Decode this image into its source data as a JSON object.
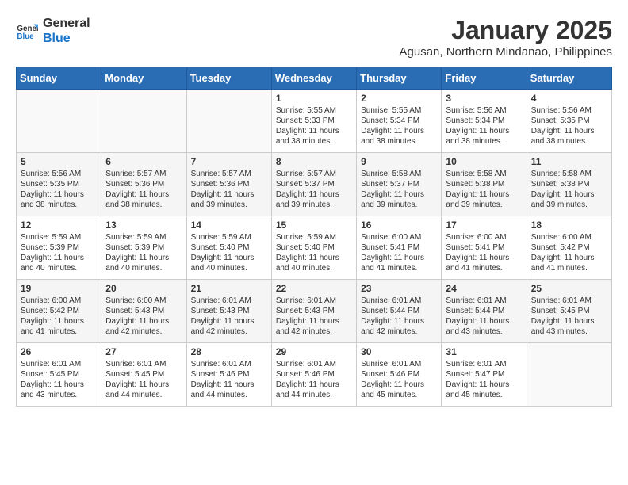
{
  "logo": {
    "line1": "General",
    "line2": "Blue"
  },
  "title": "January 2025",
  "location": "Agusan, Northern Mindanao, Philippines",
  "headers": [
    "Sunday",
    "Monday",
    "Tuesday",
    "Wednesday",
    "Thursday",
    "Friday",
    "Saturday"
  ],
  "weeks": [
    [
      {
        "day": "",
        "content": ""
      },
      {
        "day": "",
        "content": ""
      },
      {
        "day": "",
        "content": ""
      },
      {
        "day": "1",
        "content": "Sunrise: 5:55 AM\nSunset: 5:33 PM\nDaylight: 11 hours\nand 38 minutes."
      },
      {
        "day": "2",
        "content": "Sunrise: 5:55 AM\nSunset: 5:34 PM\nDaylight: 11 hours\nand 38 minutes."
      },
      {
        "day": "3",
        "content": "Sunrise: 5:56 AM\nSunset: 5:34 PM\nDaylight: 11 hours\nand 38 minutes."
      },
      {
        "day": "4",
        "content": "Sunrise: 5:56 AM\nSunset: 5:35 PM\nDaylight: 11 hours\nand 38 minutes."
      }
    ],
    [
      {
        "day": "5",
        "content": "Sunrise: 5:56 AM\nSunset: 5:35 PM\nDaylight: 11 hours\nand 38 minutes."
      },
      {
        "day": "6",
        "content": "Sunrise: 5:57 AM\nSunset: 5:36 PM\nDaylight: 11 hours\nand 38 minutes."
      },
      {
        "day": "7",
        "content": "Sunrise: 5:57 AM\nSunset: 5:36 PM\nDaylight: 11 hours\nand 39 minutes."
      },
      {
        "day": "8",
        "content": "Sunrise: 5:57 AM\nSunset: 5:37 PM\nDaylight: 11 hours\nand 39 minutes."
      },
      {
        "day": "9",
        "content": "Sunrise: 5:58 AM\nSunset: 5:37 PM\nDaylight: 11 hours\nand 39 minutes."
      },
      {
        "day": "10",
        "content": "Sunrise: 5:58 AM\nSunset: 5:38 PM\nDaylight: 11 hours\nand 39 minutes."
      },
      {
        "day": "11",
        "content": "Sunrise: 5:58 AM\nSunset: 5:38 PM\nDaylight: 11 hours\nand 39 minutes."
      }
    ],
    [
      {
        "day": "12",
        "content": "Sunrise: 5:59 AM\nSunset: 5:39 PM\nDaylight: 11 hours\nand 40 minutes."
      },
      {
        "day": "13",
        "content": "Sunrise: 5:59 AM\nSunset: 5:39 PM\nDaylight: 11 hours\nand 40 minutes."
      },
      {
        "day": "14",
        "content": "Sunrise: 5:59 AM\nSunset: 5:40 PM\nDaylight: 11 hours\nand 40 minutes."
      },
      {
        "day": "15",
        "content": "Sunrise: 5:59 AM\nSunset: 5:40 PM\nDaylight: 11 hours\nand 40 minutes."
      },
      {
        "day": "16",
        "content": "Sunrise: 6:00 AM\nSunset: 5:41 PM\nDaylight: 11 hours\nand 41 minutes."
      },
      {
        "day": "17",
        "content": "Sunrise: 6:00 AM\nSunset: 5:41 PM\nDaylight: 11 hours\nand 41 minutes."
      },
      {
        "day": "18",
        "content": "Sunrise: 6:00 AM\nSunset: 5:42 PM\nDaylight: 11 hours\nand 41 minutes."
      }
    ],
    [
      {
        "day": "19",
        "content": "Sunrise: 6:00 AM\nSunset: 5:42 PM\nDaylight: 11 hours\nand 41 minutes."
      },
      {
        "day": "20",
        "content": "Sunrise: 6:00 AM\nSunset: 5:43 PM\nDaylight: 11 hours\nand 42 minutes."
      },
      {
        "day": "21",
        "content": "Sunrise: 6:01 AM\nSunset: 5:43 PM\nDaylight: 11 hours\nand 42 minutes."
      },
      {
        "day": "22",
        "content": "Sunrise: 6:01 AM\nSunset: 5:43 PM\nDaylight: 11 hours\nand 42 minutes."
      },
      {
        "day": "23",
        "content": "Sunrise: 6:01 AM\nSunset: 5:44 PM\nDaylight: 11 hours\nand 42 minutes."
      },
      {
        "day": "24",
        "content": "Sunrise: 6:01 AM\nSunset: 5:44 PM\nDaylight: 11 hours\nand 43 minutes."
      },
      {
        "day": "25",
        "content": "Sunrise: 6:01 AM\nSunset: 5:45 PM\nDaylight: 11 hours\nand 43 minutes."
      }
    ],
    [
      {
        "day": "26",
        "content": "Sunrise: 6:01 AM\nSunset: 5:45 PM\nDaylight: 11 hours\nand 43 minutes."
      },
      {
        "day": "27",
        "content": "Sunrise: 6:01 AM\nSunset: 5:45 PM\nDaylight: 11 hours\nand 44 minutes."
      },
      {
        "day": "28",
        "content": "Sunrise: 6:01 AM\nSunset: 5:46 PM\nDaylight: 11 hours\nand 44 minutes."
      },
      {
        "day": "29",
        "content": "Sunrise: 6:01 AM\nSunset: 5:46 PM\nDaylight: 11 hours\nand 44 minutes."
      },
      {
        "day": "30",
        "content": "Sunrise: 6:01 AM\nSunset: 5:46 PM\nDaylight: 11 hours\nand 45 minutes."
      },
      {
        "day": "31",
        "content": "Sunrise: 6:01 AM\nSunset: 5:47 PM\nDaylight: 11 hours\nand 45 minutes."
      },
      {
        "day": "",
        "content": ""
      }
    ]
  ]
}
